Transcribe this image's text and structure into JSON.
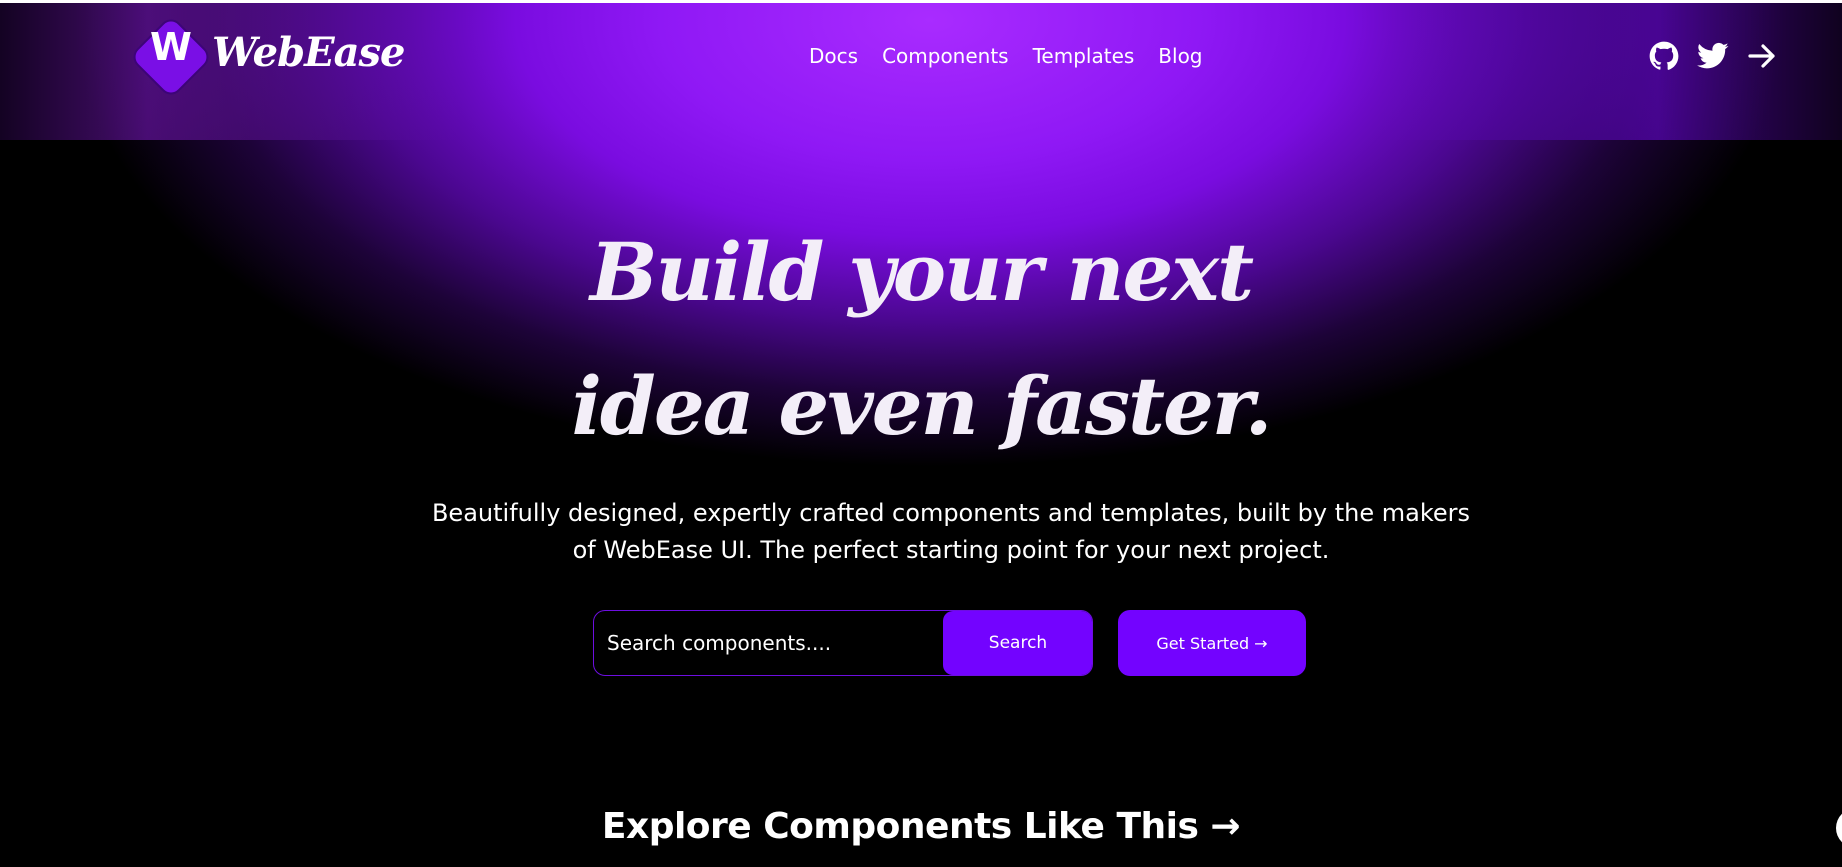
{
  "brand": {
    "letter": "W",
    "name": "WebEase"
  },
  "nav": {
    "items": [
      "Docs",
      "Components",
      "Templates",
      "Blog"
    ]
  },
  "header_icons": [
    "github-icon",
    "twitter-icon",
    "arrow-right-icon"
  ],
  "hero": {
    "title_line1": "Build your next",
    "title_line2": "idea even faster.",
    "subtitle": "Beautifully designed, expertly crafted components and templates, built by the makers of WebEase UI. The perfect starting point for your next project."
  },
  "search": {
    "placeholder": "Search components....",
    "button_label": "Search"
  },
  "cta": {
    "label": "Get Started →"
  },
  "section": {
    "title": "Explore Components Like This →"
  },
  "colors": {
    "accent": "#7303ff",
    "glow": "#a92bff",
    "background": "#000000"
  }
}
